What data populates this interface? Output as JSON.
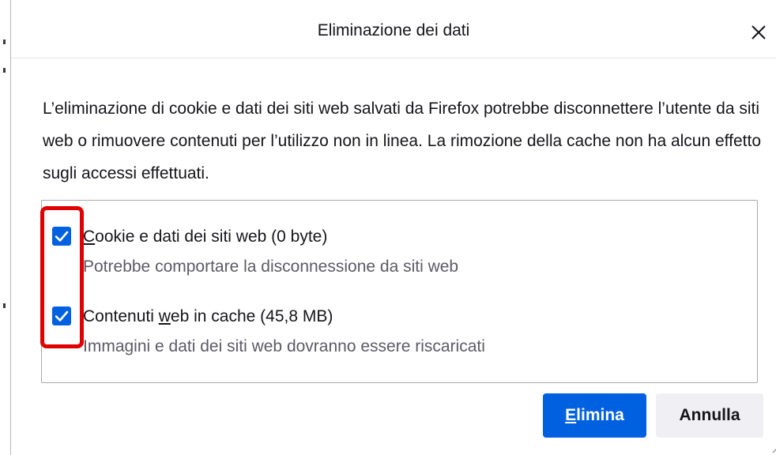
{
  "dialog": {
    "title": "Eliminazione dei dati",
    "close_icon": "close-icon",
    "description": "L’eliminazione di cookie e dati dei siti web salvati da Firefox potrebbe disconnettere l’utente da siti web o rimuovere contenuti per l’utilizzo non in linea. La rimozione della cache non ha alcun effetto sugli accessi effettuati."
  },
  "options": [
    {
      "label_accesskey": "C",
      "label_rest": "ookie e dati dei siti web (0 byte)",
      "description": "Potrebbe comportare la disconnessione da siti web",
      "checked": true
    },
    {
      "label_before": "Contenuti ",
      "label_accesskey": "w",
      "label_after": "eb in cache (45,8 MB)",
      "description": "Immagini e dati dei siti web dovranno essere riscaricati",
      "checked": true
    }
  ],
  "buttons": {
    "primary_accesskey": "E",
    "primary_rest": "limina",
    "secondary_label": "Annulla"
  },
  "colors": {
    "accent": "#0061e0",
    "highlight": "#e00000",
    "secondary_button": "#f0f0f4"
  }
}
